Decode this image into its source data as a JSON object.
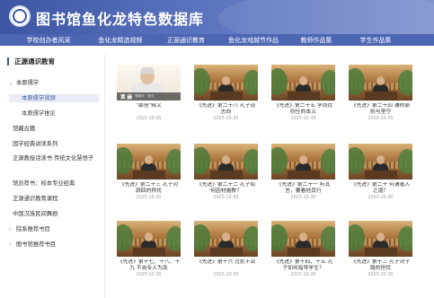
{
  "header": {
    "site_title": "图书馆鱼化龙特色数据库"
  },
  "nav": {
    "items": [
      {
        "label": "学校创办者风采"
      },
      {
        "label": "鱼化龙精选视频"
      },
      {
        "label": "正源通识教育"
      },
      {
        "label": "鱼化龙戏越节作品"
      },
      {
        "label": "教师作品集"
      },
      {
        "label": "学生作品集"
      }
    ]
  },
  "sidebar": {
    "title": "正源通识教育",
    "items": [
      {
        "label": "本原儒学",
        "chevron": "⌄"
      },
      {
        "label": "本原儒学视频"
      },
      {
        "label": "本原儒学推论"
      },
      {
        "label": "馆藏古籍"
      },
      {
        "label": "国学经典讲读系列"
      },
      {
        "label": "正源教授话读书 传统文化慧悟子"
      },
      {
        "label": "馆员荐书：校本专业经典"
      },
      {
        "label": "正源通识教育课程"
      },
      {
        "label": "中国汉族民间舞剧"
      },
      {
        "label": "院系推荐书目",
        "chevron": "›"
      },
      {
        "label": "图书馆推荐书目",
        "chevron": "›"
      }
    ]
  },
  "videos": [
    {
      "title": "\"慕信\"释义",
      "date": "2025-10-30",
      "portrait": true,
      "name": "黄 赫",
      "name_sub": "理事长 · 校长"
    },
    {
      "title": "《先进》第二十八 孔子谈志向",
      "date": "2025-10-30"
    },
    {
      "title": "《先进》第二十五 学而优则仕的本义",
      "date": "2025-10-30"
    },
    {
      "title": "《先进》第二十四 谦的原则与坚守",
      "date": "2025-10-30"
    },
    {
      "title": "《先进》第二十三 孔子对颜回的称优",
      "date": "2025-10-30"
    },
    {
      "title": "《先进》第二十二 孔子如何因材施教？",
      "date": "2025-10-30"
    },
    {
      "title": "《先进》第二十一 听其言，要看他其行",
      "date": "2025-10-30"
    },
    {
      "title": "《先进》第二十 何谓善人之道？",
      "date": "2025-10-30"
    },
    {
      "title": "《先进》第十七、十八、十九 不自专人为及",
      "date": "2025-10-30"
    },
    {
      "title": "《先进》第十六 过犹不及",
      "date": "2025-10-30"
    },
    {
      "title": "《先进》第十四、十五 孔子如何指导学生？",
      "date": "2025-10-30"
    },
    {
      "title": "《先进》第十三 孔子对子路的担忧",
      "date": "2025-10-30"
    }
  ],
  "colors": {
    "header_start": "#3d56a3",
    "nav_bg": "#4c66b4",
    "accent": "#3d56a3",
    "active_item_bg": "#e9ecf5"
  },
  "icons": {
    "logo": "library-emblem-icon"
  }
}
